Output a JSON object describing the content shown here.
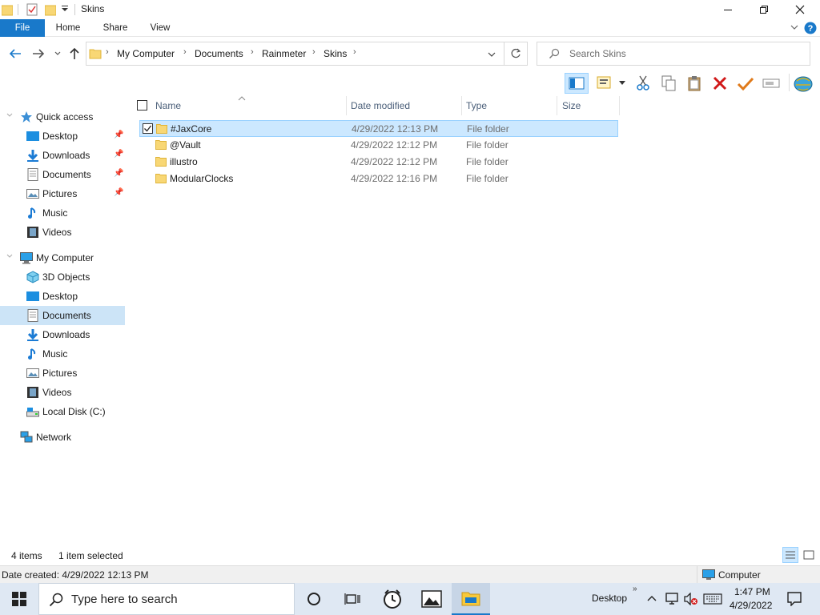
{
  "window": {
    "title": "Skins",
    "controls": {
      "minimize": "minimize",
      "maximize": "restore",
      "close": "close"
    }
  },
  "ribbon": {
    "tabs": [
      "File",
      "Home",
      "Share",
      "View"
    ]
  },
  "address": {
    "crumbs": [
      "My Computer",
      "Documents",
      "Rainmeter",
      "Skins"
    ]
  },
  "search": {
    "placeholder": "Search Skins"
  },
  "columns": {
    "name": "Name",
    "date": "Date modified",
    "type": "Type",
    "size": "Size"
  },
  "files": [
    {
      "name": "#JaxCore",
      "date": "4/29/2022 12:13 PM",
      "type": "File folder",
      "selected": true
    },
    {
      "name": "@Vault",
      "date": "4/29/2022 12:12 PM",
      "type": "File folder",
      "selected": false
    },
    {
      "name": "illustro",
      "date": "4/29/2022 12:12 PM",
      "type": "File folder",
      "selected": false
    },
    {
      "name": "ModularClocks",
      "date": "4/29/2022 12:16 PM",
      "type": "File folder",
      "selected": false
    }
  ],
  "nav": {
    "quick_access": "Quick access",
    "quick_items": [
      "Desktop",
      "Downloads",
      "Documents",
      "Pictures",
      "Music",
      "Videos"
    ],
    "my_computer": "My Computer",
    "computer_items": [
      "3D Objects",
      "Desktop",
      "Documents",
      "Downloads",
      "Music",
      "Pictures",
      "Videos",
      "Local Disk (C:)"
    ],
    "network": "Network"
  },
  "status": {
    "item_count": "4 items",
    "selected": "1 item selected",
    "details": "Date created: 4/29/2022 12:13 PM",
    "location": "Computer"
  },
  "taskbar": {
    "search_placeholder": "Type here to search",
    "desktop_label": "Desktop",
    "time": "1:47 PM",
    "date": "4/29/2022"
  },
  "colors": {
    "accent": "#1979ca",
    "selection": "#cce8ff",
    "nav_selected": "#cce4f7",
    "folder": "#f8d775"
  }
}
